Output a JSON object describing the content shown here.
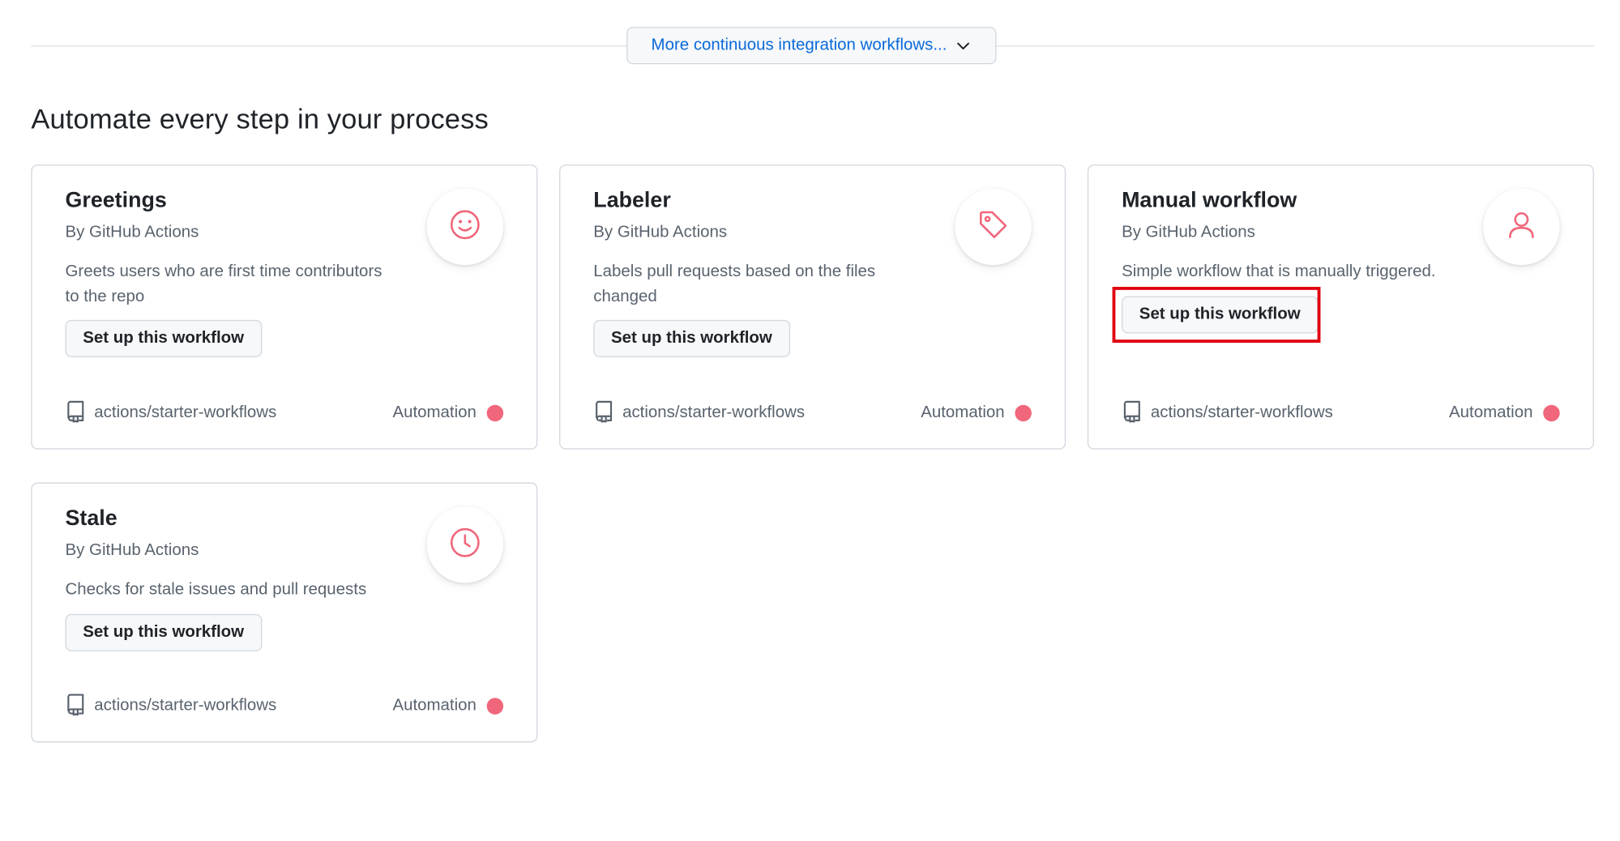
{
  "top": {
    "more_label": "More continuous integration workflows..."
  },
  "section": {
    "title": "Automate every step in your process"
  },
  "colors": {
    "accent_link": "#0969da",
    "category_dot": "#f0667a",
    "icon_color": "#f0667a",
    "highlight": "#e0000f"
  },
  "cards": [
    {
      "title": "Greetings",
      "author": "By GitHub Actions",
      "description": "Greets users who are first time contributors to the repo",
      "button": "Set up this workflow",
      "icon": "smiley-icon",
      "repo": "actions/starter-workflows",
      "category": "Automation"
    },
    {
      "title": "Labeler",
      "author": "By GitHub Actions",
      "description": "Labels pull requests based on the files changed",
      "button": "Set up this workflow",
      "icon": "tag-icon",
      "repo": "actions/starter-workflows",
      "category": "Automation"
    },
    {
      "title": "Manual workflow",
      "author": "By GitHub Actions",
      "description": "Simple workflow that is manually triggered.",
      "button": "Set up this workflow",
      "icon": "person-icon",
      "repo": "actions/starter-workflows",
      "category": "Automation"
    },
    {
      "title": "Stale",
      "author": "By GitHub Actions",
      "description": "Checks for stale issues and pull requests",
      "button": "Set up this workflow",
      "icon": "clock-icon",
      "repo": "actions/starter-workflows",
      "category": "Automation"
    }
  ]
}
